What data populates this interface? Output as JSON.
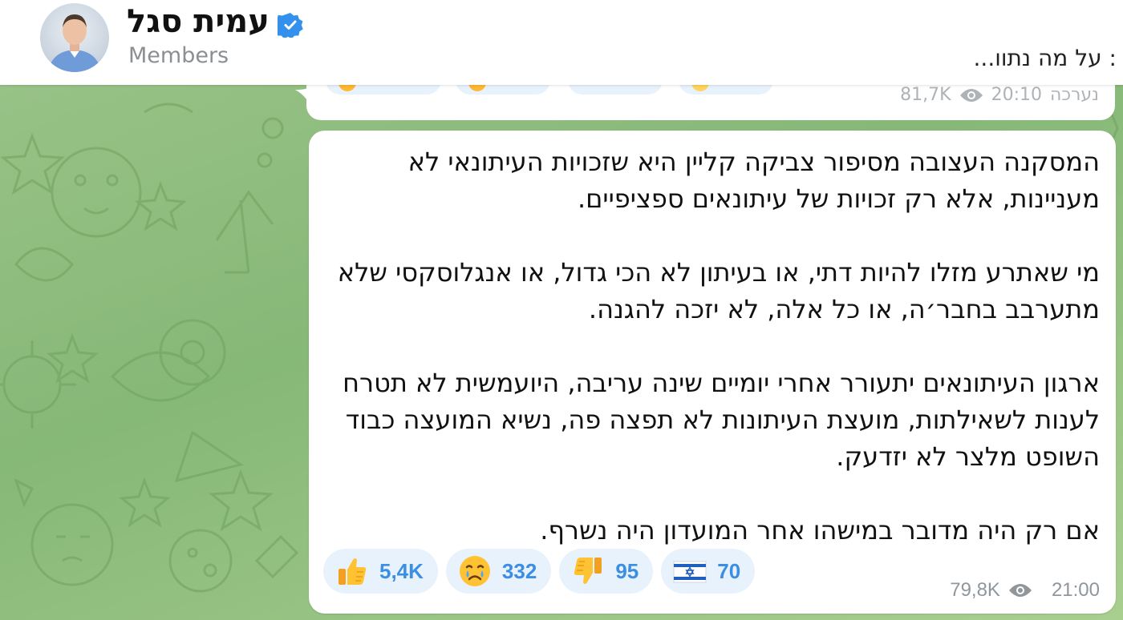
{
  "header": {
    "title": "עמית סגל",
    "subtitle": "Members",
    "pinned_message": ": על מה נתוו..."
  },
  "previous_message": {
    "views": "81,7K",
    "time": "20:10",
    "author_partial": "נערכה"
  },
  "message": {
    "paragraphs": [
      "המסקנה העצובה מסיפור צביקה קליין היא שזכויות העיתונאי לא מעניינות, אלא רק זכויות של עיתונאים ספציפיים.",
      "מי שאתרע מזלו להיות דתי, או בעיתון לא הכי גדול, או אנגלוסקסי שלא מתערבב בחבר׳ה, או כל אלה, לא יזכה להגנה.",
      "ארגון העיתונאים יתעורר אחרי יומיים שינה עריבה, היועמשית לא תטרח לענות לשאילתות, מועצת העיתונות לא תפצה פה, נשיא המועצה כבוד השופט מלצר לא יזדעק.",
      "אם רק היה מדובר במישהו אחר המועדון היה נשרף."
    ],
    "reactions": [
      {
        "emoji": "thumbs-up",
        "count": "5,4K"
      },
      {
        "emoji": "crying-face",
        "count": "332"
      },
      {
        "emoji": "thumbs-down",
        "count": "95"
      },
      {
        "emoji": "israel-flag",
        "count": "70"
      }
    ],
    "views": "79,8K",
    "time": "21:00"
  },
  "colors": {
    "accent": "#3b8ee2",
    "reaction_bg": "#e8f2fd",
    "wallpaper": "#8fbc7e",
    "verified": "#3390ec"
  }
}
